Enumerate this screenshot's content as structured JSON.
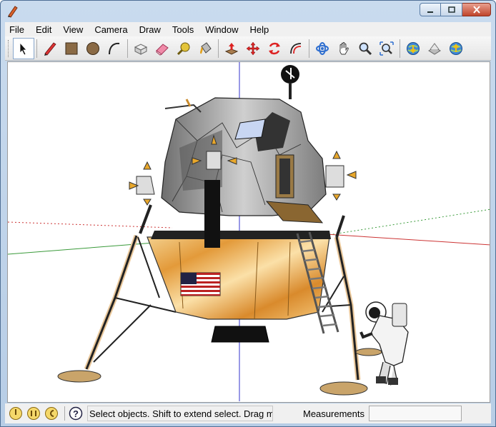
{
  "window": {
    "title": "",
    "controls": [
      "minimize",
      "maximize",
      "close"
    ]
  },
  "menu": [
    "File",
    "Edit",
    "View",
    "Camera",
    "Draw",
    "Tools",
    "Window",
    "Help"
  ],
  "toolbar": {
    "tools": [
      {
        "name": "select-tool",
        "icon": "arrow-cursor-icon",
        "active": true
      },
      {
        "name": "line-tool",
        "icon": "pencil-icon"
      },
      {
        "name": "rectangle-tool",
        "icon": "rectangle-icon"
      },
      {
        "name": "circle-tool",
        "icon": "circle-icon"
      },
      {
        "name": "arc-tool",
        "icon": "arc-icon"
      },
      {
        "name": "make-component-tool",
        "icon": "component-box-icon"
      },
      {
        "name": "eraser-tool",
        "icon": "eraser-icon"
      },
      {
        "name": "tape-measure-tool",
        "icon": "tape-measure-icon"
      },
      {
        "name": "paint-bucket-tool",
        "icon": "paint-bucket-icon"
      },
      {
        "name": "push-pull-tool",
        "icon": "push-pull-icon"
      },
      {
        "name": "move-tool",
        "icon": "move-icon"
      },
      {
        "name": "rotate-tool",
        "icon": "rotate-icon"
      },
      {
        "name": "offset-tool",
        "icon": "offset-icon"
      },
      {
        "name": "orbit-tool",
        "icon": "orbit-icon"
      },
      {
        "name": "pan-tool",
        "icon": "hand-icon"
      },
      {
        "name": "zoom-tool",
        "icon": "magnifier-icon"
      },
      {
        "name": "zoom-extents-tool",
        "icon": "zoom-extents-icon"
      },
      {
        "name": "get-models-tool",
        "icon": "globe-download-icon"
      },
      {
        "name": "share-model-tool",
        "icon": "share-icon"
      },
      {
        "name": "upload-tool",
        "icon": "globe-upload-icon"
      }
    ]
  },
  "statusbar": {
    "icons": [
      "geo-location-icon",
      "credits-icon",
      "user-icon",
      "help-icon"
    ],
    "message": "Select objects. Shift to extend select. Drag mouse to select multiple.",
    "measurements_label": "Measurements",
    "measurements_value": ""
  },
  "colors": {
    "axis_red": "#cc3333",
    "axis_green": "#3a9a3a",
    "axis_blue": "#3333cc",
    "gold_foil": "#e7a84b",
    "lander_gray": "#8c8c8c"
  }
}
